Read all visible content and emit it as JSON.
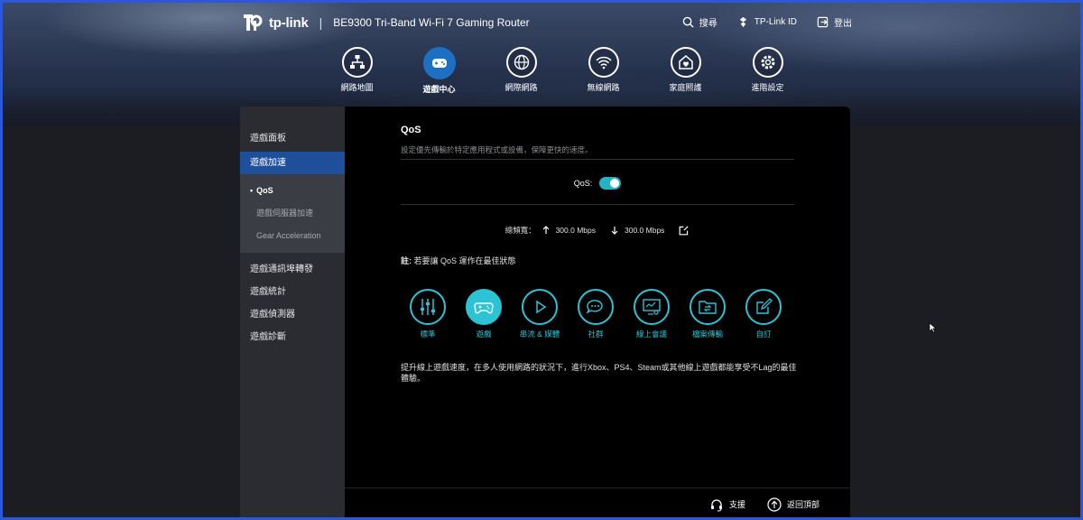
{
  "brand": {
    "logo_text": "tp-link",
    "separator": "|",
    "model": "BE9300 Tri-Band Wi-Fi 7 Gaming Router"
  },
  "top_actions": [
    {
      "icon": "search-icon",
      "label": "搜尋"
    },
    {
      "icon": "tplink-id-icon",
      "label": "TP-Link ID"
    },
    {
      "icon": "logout-icon",
      "label": "登出"
    }
  ],
  "main_nav": [
    {
      "icon": "network-map-icon",
      "label": "網路地圖",
      "active": false
    },
    {
      "icon": "gamepad-icon",
      "label": "遊戲中心",
      "active": true
    },
    {
      "icon": "globe-icon",
      "label": "網際網路",
      "active": false
    },
    {
      "icon": "wifi-icon",
      "label": "無線網路",
      "active": false
    },
    {
      "icon": "home-care-icon",
      "label": "家庭照護",
      "active": false
    },
    {
      "icon": "gear-icon",
      "label": "進階設定",
      "active": false
    }
  ],
  "sidebar": {
    "items_top": [
      "遊戲面板"
    ],
    "active_item": "遊戲加速",
    "sub_items": [
      {
        "label": "QoS",
        "active": true
      },
      {
        "label": "遊戲伺服器加速",
        "active": false
      },
      {
        "label": "Gear Acceleration",
        "active": false
      }
    ],
    "items_bottom": [
      "遊戲通訊埠轉發",
      "遊戲統計",
      "遊戲偵測器",
      "遊戲診斷"
    ]
  },
  "qos": {
    "title": "QoS",
    "description": "設定優先傳輸於特定應用程式或設備，保障更快的速度。",
    "toggle_label": "QoS:",
    "toggle_on": true,
    "bandwidth_label": "總頻寬：",
    "upload": "300.0 Mbps",
    "download": "300.0 Mbps",
    "note_bold": "註:",
    "note_text": " 若要讓 QoS 運作在最佳狀態"
  },
  "modes": [
    {
      "icon": "sliders-icon",
      "label": "標準",
      "active": false
    },
    {
      "icon": "gamepad-icon",
      "label": "遊戲",
      "active": true
    },
    {
      "icon": "play-icon",
      "label": "串流 & 媒體",
      "active": false
    },
    {
      "icon": "chat-icon",
      "label": "社群",
      "active": false
    },
    {
      "icon": "meeting-icon",
      "label": "線上會議",
      "active": false
    },
    {
      "icon": "folder-transfer-icon",
      "label": "檔案傳輸",
      "active": false
    },
    {
      "icon": "edit-icon",
      "label": "自訂",
      "active": false
    }
  ],
  "mode_description": "提升線上遊戲速度，在多人使用網路的狀況下，進行Xbox、PS4、Steam或其他線上遊戲都能享受不Lag的最佳體驗。",
  "footer": {
    "support": "支援",
    "back_to_top": "返回頂部"
  },
  "colors": {
    "accent": "#2cc3d4",
    "nav_active": "#1d6fc2",
    "sidebar_active": "#1f4f9a"
  }
}
